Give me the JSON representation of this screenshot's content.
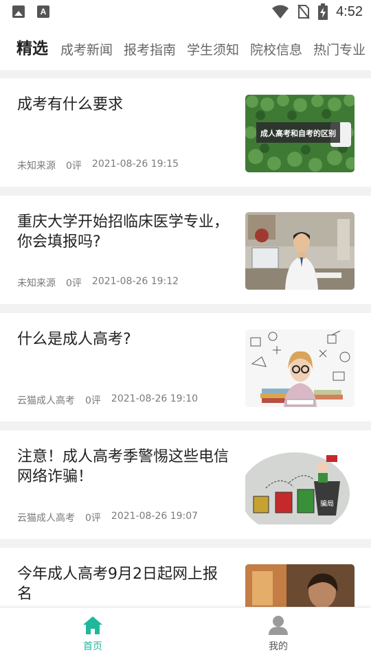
{
  "status_bar": {
    "time": "4:52",
    "icons": [
      "image-icon",
      "text-a-icon",
      "wifi-icon",
      "no-sim-icon",
      "battery-charging-icon"
    ]
  },
  "tabs": [
    {
      "label": "精选",
      "active": true
    },
    {
      "label": "成考新闻",
      "active": false
    },
    {
      "label": "报考指南",
      "active": false
    },
    {
      "label": "学生须知",
      "active": false
    },
    {
      "label": "院校信息",
      "active": false
    },
    {
      "label": "热门专业",
      "active": false
    }
  ],
  "articles": [
    {
      "title": "成考有什么要求",
      "source": "未知来源",
      "comments": "0评",
      "date": "2021-08-26 19:15",
      "thumb_caption": "成人高考和自考的区别"
    },
    {
      "title": "重庆大学开始招临床医学专业，你会填报吗?",
      "source": "未知来源",
      "comments": "0评",
      "date": "2021-08-26 19:12"
    },
    {
      "title": "什么是成人高考?",
      "source": "云猫成人高考",
      "comments": "0评",
      "date": "2021-08-26 19:10"
    },
    {
      "title": "注意！成人高考季警惕这些电信网络诈骗！",
      "source": "云猫成人高考",
      "comments": "0评",
      "date": "2021-08-26 19:07",
      "thumb_caption": "骗局"
    },
    {
      "title": "今年成人高考9月2日起网上报名",
      "source": "",
      "comments": "",
      "date": ""
    }
  ],
  "bottom_nav": {
    "home_label": "首页",
    "mine_label": "我的",
    "accent_color": "#1fb89a",
    "inactive_color": "#555555"
  }
}
